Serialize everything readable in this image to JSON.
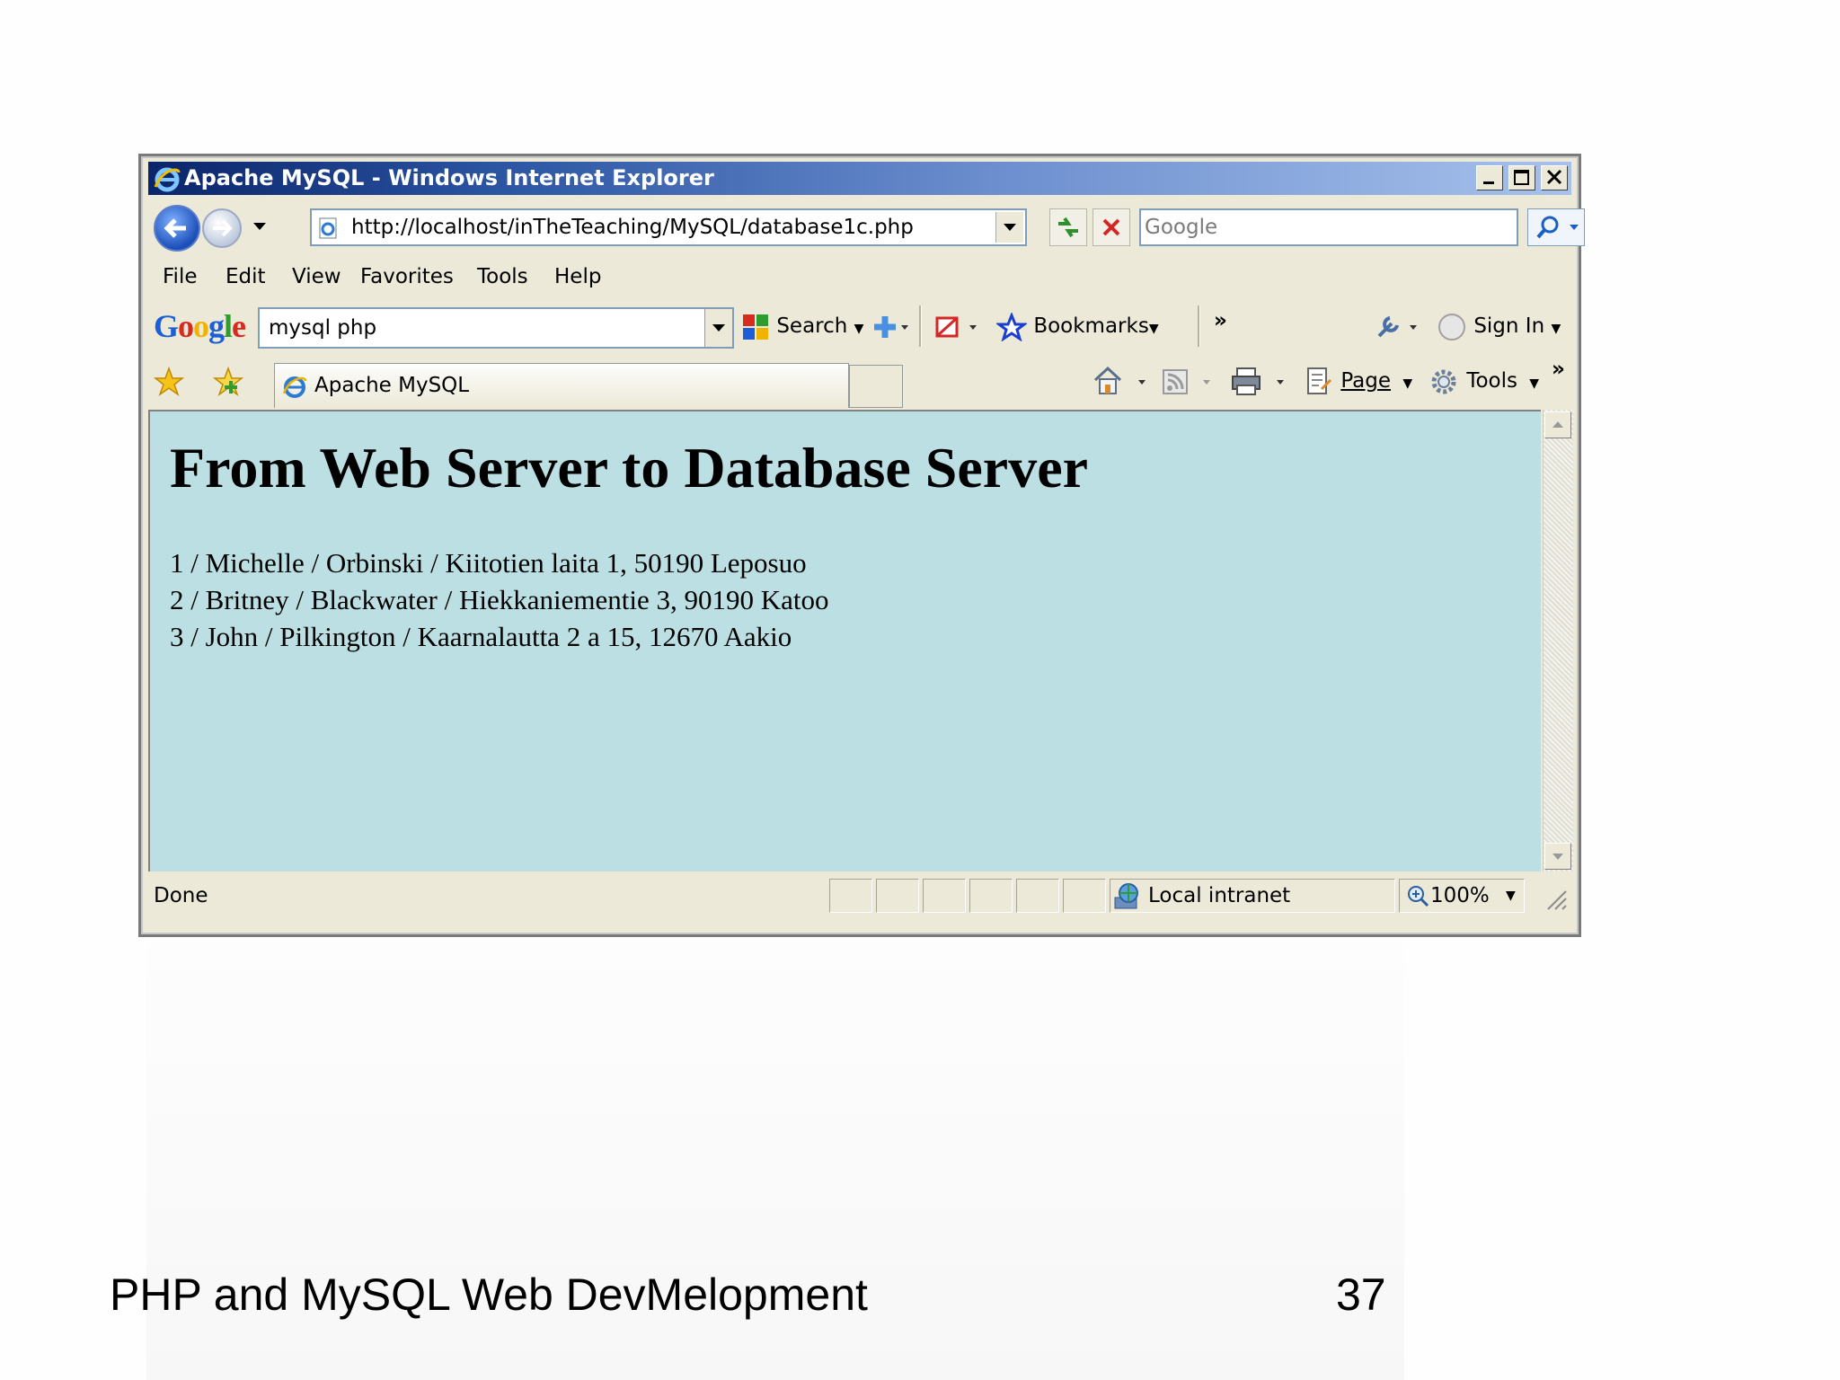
{
  "window": {
    "title": "Apache MySQL - Windows Internet Explorer"
  },
  "nav": {
    "address": "http://localhost/inTheTeaching/MySQL/database1c.php",
    "search_placeholder": "Google"
  },
  "menu": {
    "items": [
      "File",
      "Edit",
      "View",
      "Favorites",
      "Tools",
      "Help"
    ]
  },
  "google_toolbar": {
    "logo": "Google",
    "query": "mysql php",
    "search_label": "Search",
    "bookmarks_label": "Bookmarks",
    "more_label": "»",
    "sign_in_label": "Sign In"
  },
  "tabs": {
    "active_tab": "Apache MySQL"
  },
  "command_bar": {
    "page_label": "Page",
    "tools_label": "Tools",
    "more_label": "»"
  },
  "page": {
    "heading": "From Web Server to Database Server",
    "rows": [
      "1 / Michelle / Orbinski / Kiitotien laita 1, 50190 Leposuo",
      "2 / Britney / Blackwater / Hiekkaniementie 3, 90190 Katoo",
      "3 / John / Pilkington / Kaarnalautta 2 a 15, 12670 Aakio"
    ]
  },
  "status_bar": {
    "status": "Done",
    "zone": "Local intranet",
    "zoom": "100%"
  },
  "slide": {
    "footer_text": "PHP and MySQL Web DevMelopment",
    "page_number": "37"
  }
}
